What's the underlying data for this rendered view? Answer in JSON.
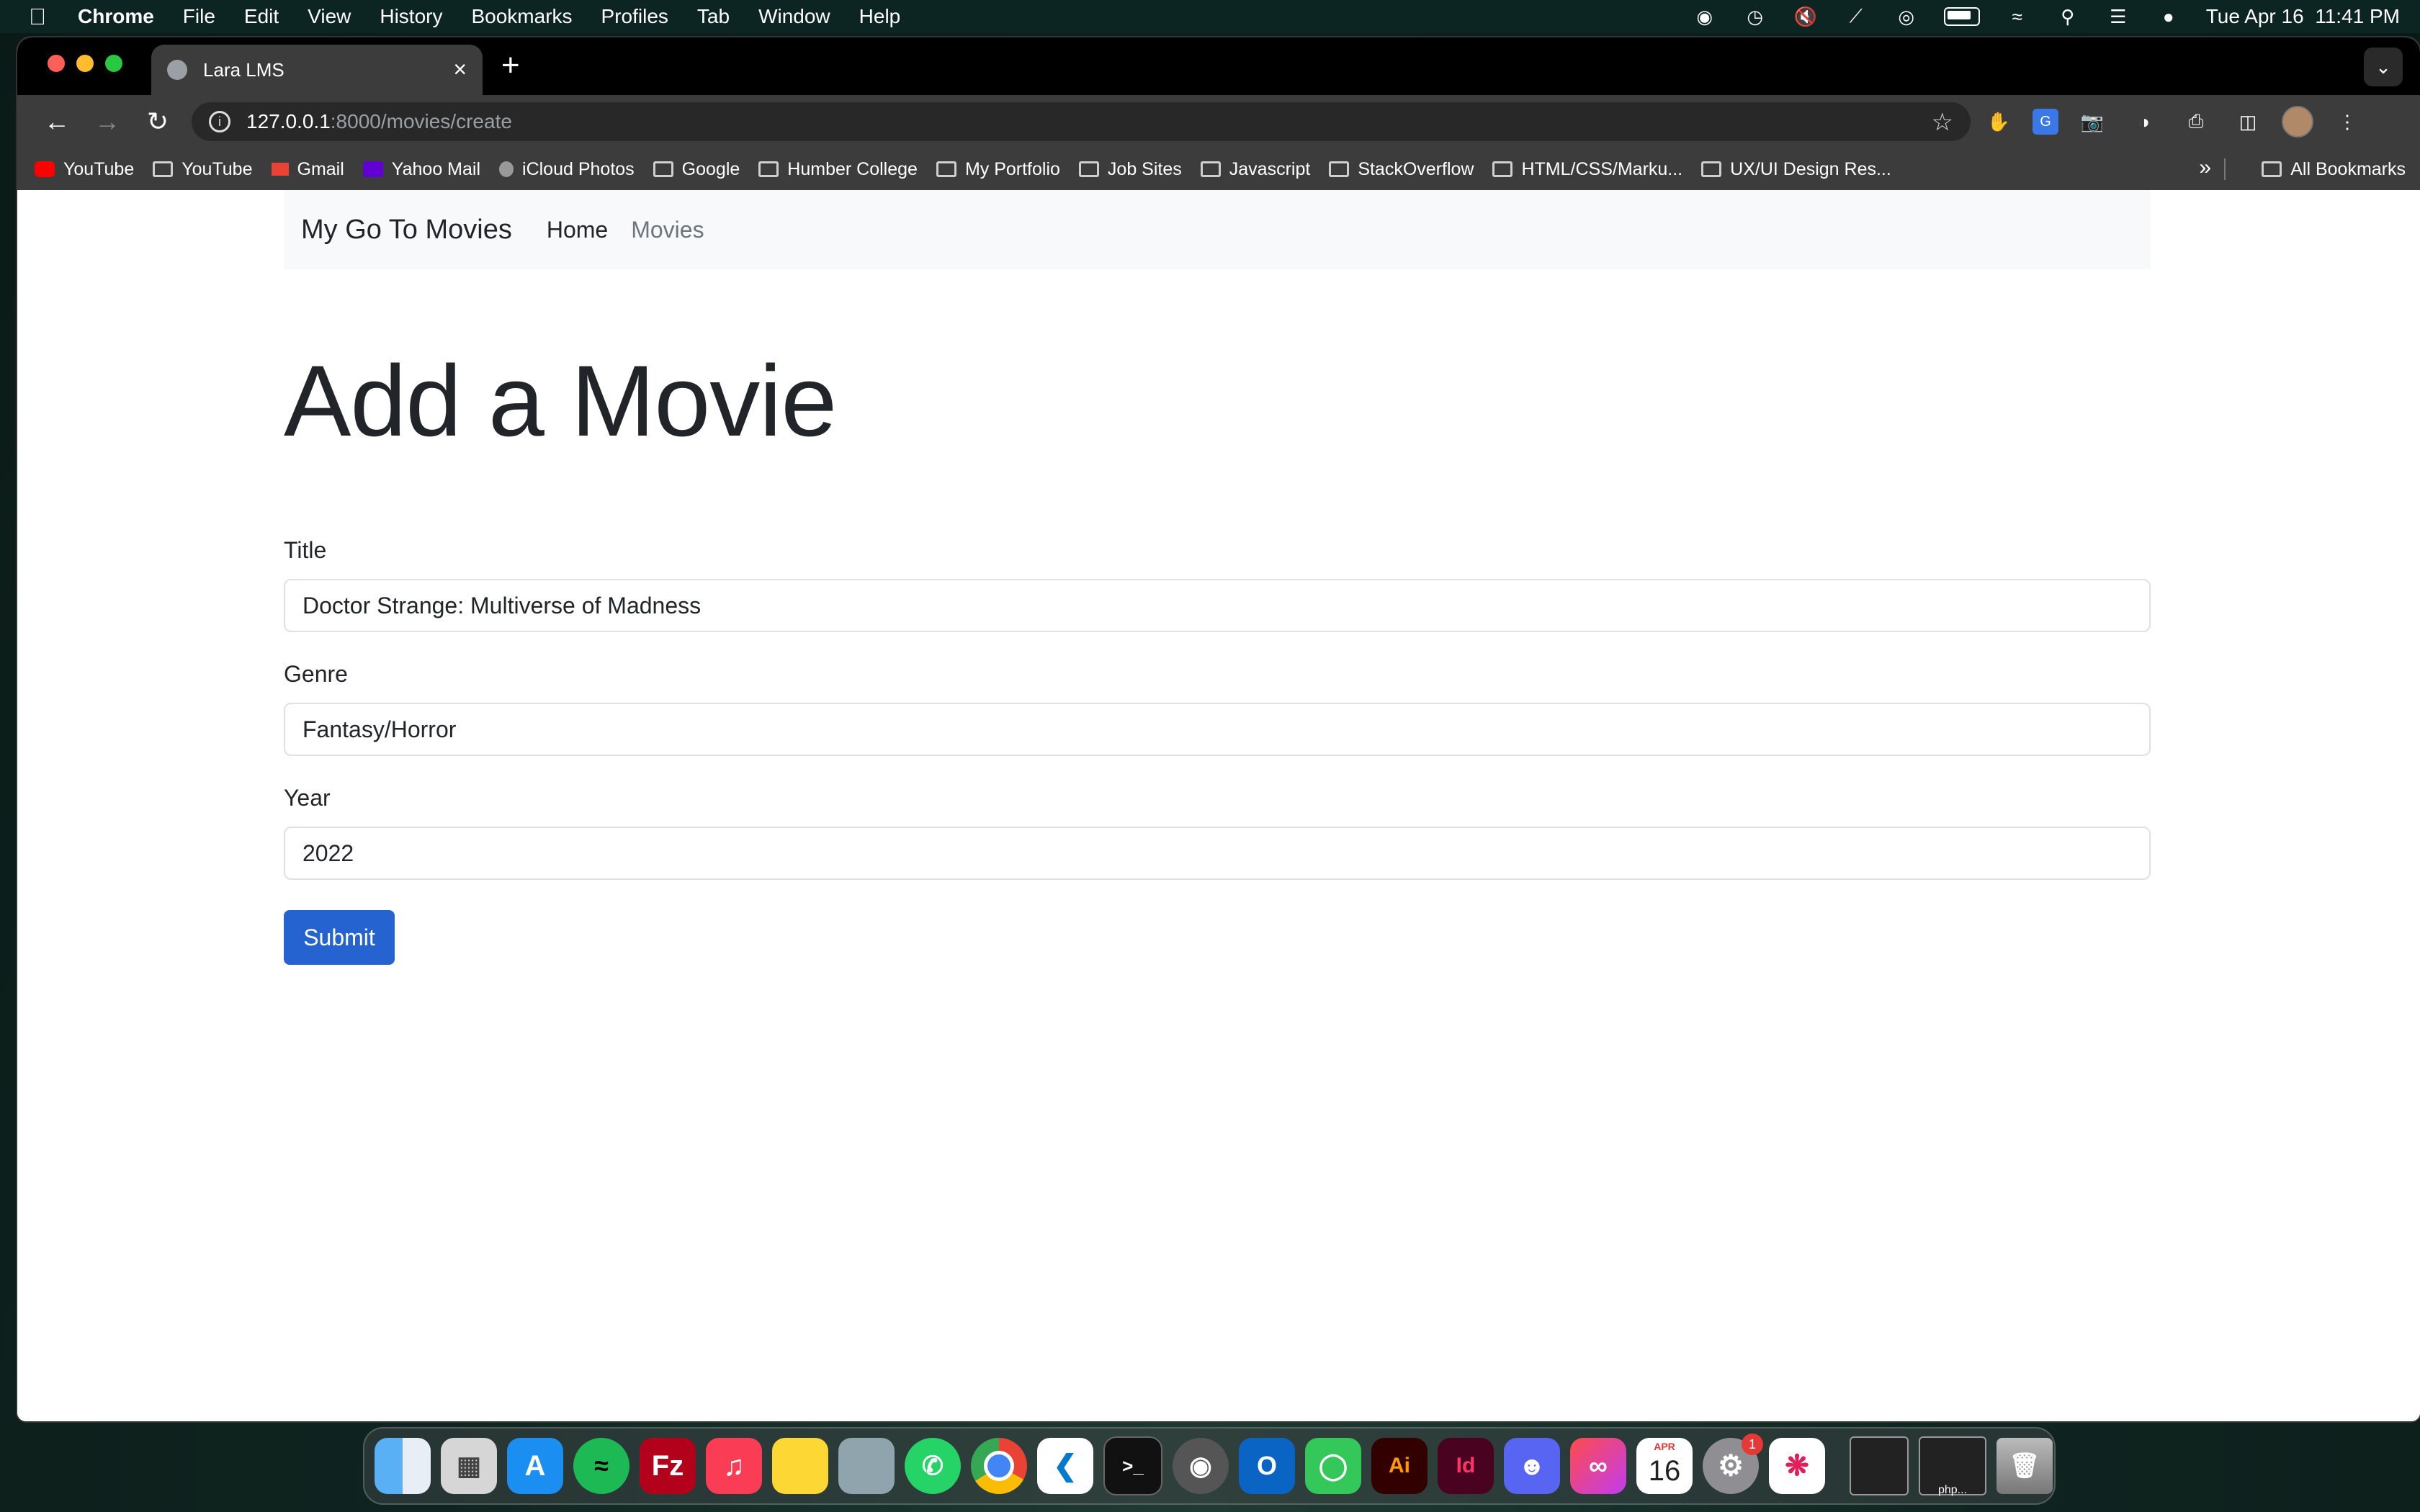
{
  "menubar": {
    "app": "Chrome",
    "items": [
      "File",
      "Edit",
      "View",
      "History",
      "Bookmarks",
      "Profiles",
      "Tab",
      "Window",
      "Help"
    ],
    "datetime": "Tue Apr 16  11:41 PM"
  },
  "browser": {
    "tab_title": "Lara LMS",
    "url_host": "127.0.0.1",
    "url_path": ":8000/movies/create",
    "bookmarks": [
      {
        "label": "YouTube",
        "icon": "youtube-icon"
      },
      {
        "label": "YouTube",
        "icon": "folder-icon"
      },
      {
        "label": "Gmail",
        "icon": "gmail-icon"
      },
      {
        "label": "Yahoo Mail",
        "icon": "yahoo-icon"
      },
      {
        "label": "iCloud Photos",
        "icon": "apple-icon"
      },
      {
        "label": "Google",
        "icon": "folder-icon"
      },
      {
        "label": "Humber College",
        "icon": "folder-icon"
      },
      {
        "label": "My Portfolio",
        "icon": "folder-icon"
      },
      {
        "label": "Job Sites",
        "icon": "folder-icon"
      },
      {
        "label": "Javascript",
        "icon": "folder-icon"
      },
      {
        "label": "StackOverflow",
        "icon": "folder-icon"
      },
      {
        "label": "HTML/CSS/Marku...",
        "icon": "folder-icon"
      },
      {
        "label": "UX/UI Design Res...",
        "icon": "folder-icon"
      }
    ],
    "all_bookmarks": "All Bookmarks"
  },
  "site": {
    "brand": "My Go To Movies",
    "nav": {
      "home": "Home",
      "movies": "Movies"
    },
    "heading": "Add a Movie",
    "form": {
      "title_label": "Title",
      "title_value": "Doctor Strange: Multiverse of Madness",
      "genre_label": "Genre",
      "genre_value": "Fantasy/Horror",
      "year_label": "Year",
      "year_value": "2022",
      "submit": "Submit"
    }
  },
  "dock": {
    "calendar_month": "APR",
    "calendar_day": "16",
    "settings_badge": "1",
    "illustrator": "Ai",
    "indesign": "Id",
    "thumb_label": "php..."
  },
  "colors": {
    "primary": "#2563d1",
    "navbar_bg": "#f8f9fa",
    "text": "#212529",
    "muted": "#6c757d"
  }
}
